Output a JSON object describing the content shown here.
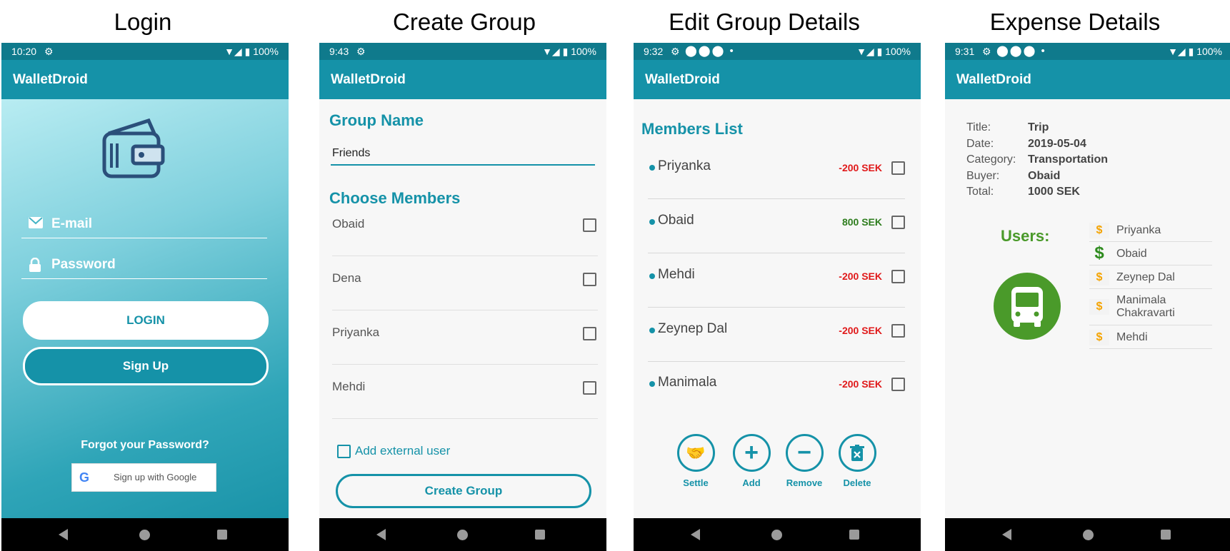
{
  "titles": {
    "login": "Login",
    "create": "Create Group",
    "edit": "Edit Group Details",
    "expense": "Expense Details"
  },
  "app_name": "WalletDroid",
  "login": {
    "time": "10:20",
    "battery": "100%",
    "email_placeholder": "E-mail",
    "password_placeholder": "Password",
    "login_button": "LOGIN",
    "signup_button": "Sign Up",
    "forgot": "Forgot your Password?",
    "google": "Sign up with Google"
  },
  "create_group": {
    "time": "9:43",
    "battery": "100%",
    "group_name_label": "Group Name",
    "group_name_value": "Friends",
    "choose_members_label": "Choose Members",
    "members": [
      "Obaid",
      "Dena",
      "Priyanka",
      "Mehdi"
    ],
    "add_external": "Add external user",
    "create_button": "Create Group"
  },
  "edit_group": {
    "time": "9:32",
    "battery": "100%",
    "members_list_label": "Members List",
    "members": [
      {
        "name": "Priyanka",
        "amount": "-200 SEK",
        "color": "#e0191a"
      },
      {
        "name": "Obaid",
        "amount": "800 SEK",
        "color": "#2e7d1e"
      },
      {
        "name": "Mehdi",
        "amount": "-200 SEK",
        "color": "#e0191a"
      },
      {
        "name": "Zeynep Dal",
        "amount": "-200 SEK",
        "color": "#e0191a"
      },
      {
        "name": "Manimala",
        "amount": "-200 SEK",
        "color": "#e0191a"
      }
    ],
    "actions": [
      {
        "label": "Settle",
        "icon": "handshake-icon"
      },
      {
        "label": "Add",
        "icon": "plus-icon"
      },
      {
        "label": "Remove",
        "icon": "minus-icon"
      },
      {
        "label": "Delete",
        "icon": "trash-icon"
      }
    ]
  },
  "expense": {
    "time": "9:31",
    "battery": "100%",
    "details": [
      {
        "key": "Title:",
        "value": "Trip"
      },
      {
        "key": "Date:",
        "value": "2019-05-04"
      },
      {
        "key": "Category:",
        "value": "Transportation"
      },
      {
        "key": "Buyer:",
        "value": "Obaid"
      },
      {
        "key": "Total:",
        "value": "1000 SEK"
      }
    ],
    "users_label": "Users:",
    "users": [
      "Priyanka",
      "Obaid",
      "Zeynep Dal",
      "Manimala Chakravarti",
      "Mehdi"
    ],
    "category_icon": "bus-icon"
  },
  "colors": {
    "status_bar": "#0f7a8c",
    "app_bar": "#1592a8",
    "green": "#4a9a2a",
    "orange_dollar": "#f4a300"
  }
}
